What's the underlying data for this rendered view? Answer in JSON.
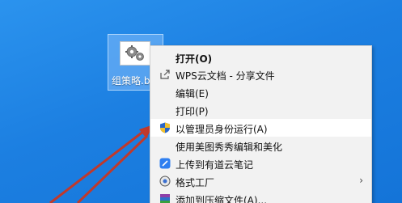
{
  "desktop": {
    "icon_label": "组策略.b"
  },
  "context_menu": {
    "items": [
      {
        "label": "打开(O)",
        "icon": "none",
        "bold": true
      },
      {
        "label": "WPS云文档 - 分享文件",
        "icon": "share-icon"
      },
      {
        "label": "编辑(E)",
        "icon": "none"
      },
      {
        "label": "打印(P)",
        "icon": "none"
      },
      {
        "label": "以管理员身份运行(A)",
        "icon": "uac-shield-icon",
        "highlighted": true
      },
      {
        "label": "使用美图秀秀编辑和美化",
        "icon": "none"
      },
      {
        "label": "上传到有道云笔记",
        "icon": "youdao-note-icon"
      },
      {
        "label": "格式工厂",
        "icon": "format-factory-icon",
        "submenu_arrow": "›"
      },
      {
        "label": "添加到压缩文件(A)...",
        "icon": "winrar-icon"
      }
    ]
  },
  "colors": {
    "desktop": "#1c7fe1",
    "menu_bg": "#f2f2f2",
    "arrow": "#c0392b"
  }
}
